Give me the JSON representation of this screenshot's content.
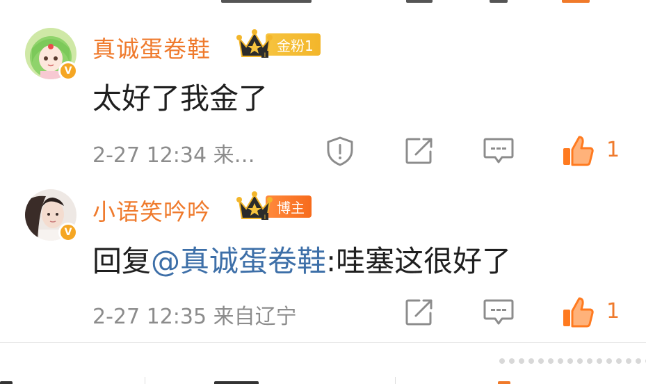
{
  "comments": [
    {
      "username": "真诚蛋卷鞋",
      "badge_label": "金粉1",
      "body": "太好了我金了",
      "meta": "2-27 12:34 来…",
      "likes": "1",
      "avatar_icon": "anime-girl-avatar",
      "verified_icon": "verified-v-icon"
    },
    {
      "username": "小语笑吟吟",
      "badge_label": "博主",
      "body_prefix": "回复",
      "mention": "@真诚蛋卷鞋",
      "body_suffix": ":哇塞这很好了",
      "meta": "2-27 12:35 来自辽宁",
      "likes": "1",
      "avatar_icon": "photo-avatar",
      "verified_icon": "verified-v-icon"
    }
  ],
  "colors": {
    "username": "#ef7a2c",
    "mention": "#3d6fa8",
    "meta": "#8c8c8c",
    "like": "#ef7a2c",
    "badge_gold": "#f6c33e",
    "badge_orange": "#f76b1c"
  }
}
